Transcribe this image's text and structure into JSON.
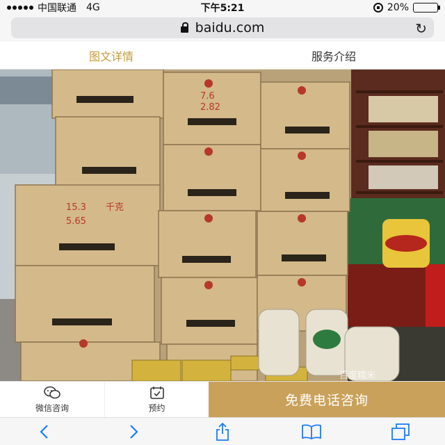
{
  "status_bar": {
    "carrier": "中国联通",
    "network": "4G",
    "time": "下午5:21",
    "battery_percent_label": "20%",
    "battery_level": 0.2
  },
  "browser": {
    "url": "baidu.com"
  },
  "tabs": [
    {
      "label": "图文详情",
      "active": true
    },
    {
      "label": "服务介绍",
      "active": false
    }
  ],
  "photo": {
    "watermark": "百度糯米",
    "box_labels": [
      "15.3",
      "5.65",
      "千克",
      "7.6",
      "2.82"
    ]
  },
  "actions": {
    "wechat_label": "微信咨询",
    "booking_label": "预约",
    "call_label": "免费电话咨询"
  },
  "colors": {
    "accent": "#c49a3a",
    "call_button": "#c9a15a",
    "ios_blue": "#1a7cf5"
  }
}
